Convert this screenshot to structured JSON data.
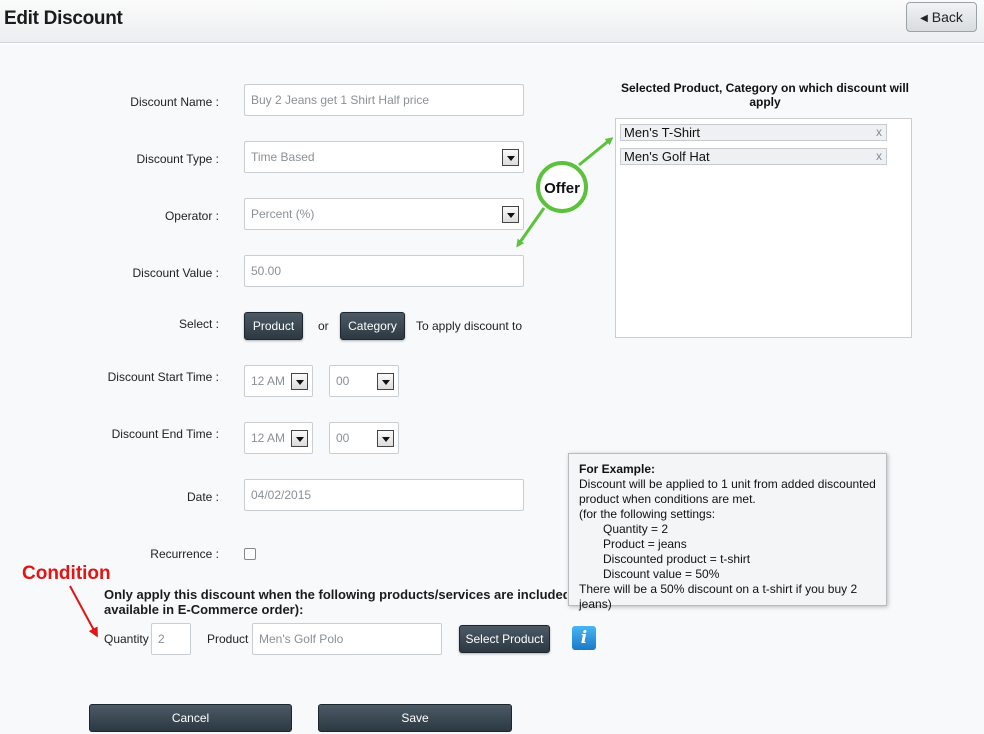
{
  "header": {
    "title": "Edit Discount",
    "back_label": "Back"
  },
  "form": {
    "discount_name_label": "Discount Name :",
    "discount_name_value": "Buy 2 Jeans get 1 Shirt Half price",
    "discount_type_label": "Discount Type :",
    "discount_type_value": "Time Based",
    "operator_label": "Operator :",
    "operator_value": "Percent (%)",
    "discount_value_label": "Discount Value :",
    "discount_value_value": "50.00",
    "select_label": "Select :",
    "product_button": "Product",
    "or_text": "or",
    "category_button": "Category",
    "apply_text": "To apply discount to",
    "start_time_label": "Discount Start Time :",
    "start_hour": "12 AM",
    "start_minute": "00",
    "end_time_label": "Discount End Time :",
    "end_hour": "12 AM",
    "end_minute": "00",
    "date_label": "Date :",
    "date_value": "04/02/2015",
    "recurrence_label": "Recurrence :",
    "recurrence_checked": false
  },
  "selected": {
    "title": "Selected Product, Category on which discount will apply",
    "items": [
      {
        "label": "Men's T-Shirt",
        "remove": "x"
      },
      {
        "label": "Men's Golf Hat",
        "remove": "x"
      }
    ]
  },
  "condition": {
    "heading_line1": "Only apply this discount when the following products/services are included i",
    "heading_line2": "available in E-Commerce order):",
    "quantity_label": "Quantity :",
    "quantity_value": "2",
    "product_label": "Product :",
    "product_value": "Men's Golf Polo",
    "select_product_button": "Select Product",
    "info_icon": "i"
  },
  "example": {
    "title": "For Example:",
    "line1": "Discount will be applied to 1 unit from added discounted",
    "line2": "product when conditions are met.",
    "line3": "(for the following settings:",
    "line4": "Quantity = 2",
    "line5": "Product = jeans",
    "line6": "Discounted product = t-shirt",
    "line7": "Discount value = 50%",
    "line8": "There will be a 50% discount on a t-shirt if you buy 2 jeans)"
  },
  "annotations": {
    "offer": "Offer",
    "condition": "Condition",
    "offer_color": "#5cc13c",
    "condition_color": "#e01515"
  },
  "footer": {
    "cancel_label": "Cancel",
    "save_label": "Save"
  }
}
